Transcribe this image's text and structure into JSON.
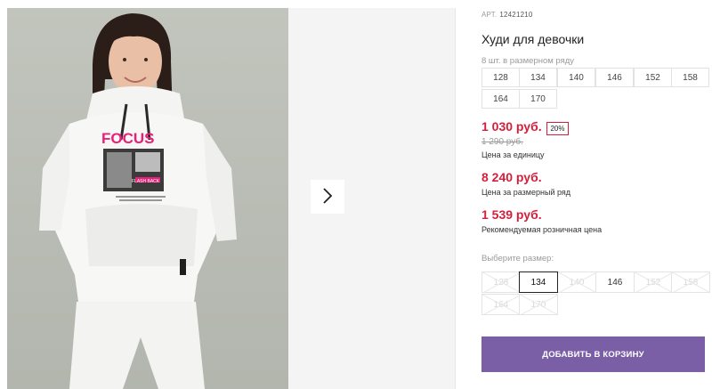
{
  "product": {
    "sku_label": "АРТ.",
    "sku_value": "12421210",
    "title": "Худи для девочки"
  },
  "size_row": {
    "caption": "8 шт. в размерном ряду",
    "sizes": [
      "128",
      "134",
      "140",
      "146",
      "152",
      "158",
      "164",
      "170"
    ]
  },
  "prices": {
    "unit_price": "1 030 руб.",
    "discount_badge": "20%",
    "old_price": "1 290 руб.",
    "unit_caption": "Цена за единицу",
    "row_price": "8 240 руб.",
    "row_caption": "Цена за размерный ряд",
    "retail_price": "1 539 руб.",
    "retail_caption": "Рекомендуемая розничная цена",
    "price_color": "#d51f3a"
  },
  "size_select": {
    "caption": "Выберите размер:",
    "options": [
      {
        "label": "128",
        "state": "disabled"
      },
      {
        "label": "134",
        "state": "selected"
      },
      {
        "label": "140",
        "state": "disabled"
      },
      {
        "label": "146",
        "state": "available"
      },
      {
        "label": "152",
        "state": "disabled"
      },
      {
        "label": "158",
        "state": "disabled"
      },
      {
        "label": "164",
        "state": "disabled"
      },
      {
        "label": "170",
        "state": "disabled"
      }
    ]
  },
  "cart": {
    "add_label": "ДОБАВИТЬ В КОРЗИНУ",
    "button_color": "#7a5fa6"
  },
  "gallery": {
    "next_icon": "chevron-right-icon",
    "hoodie_print": {
      "brand_text": "FOCUS",
      "badge_text": "FLASH BACK",
      "accent": "#e8207a"
    }
  }
}
